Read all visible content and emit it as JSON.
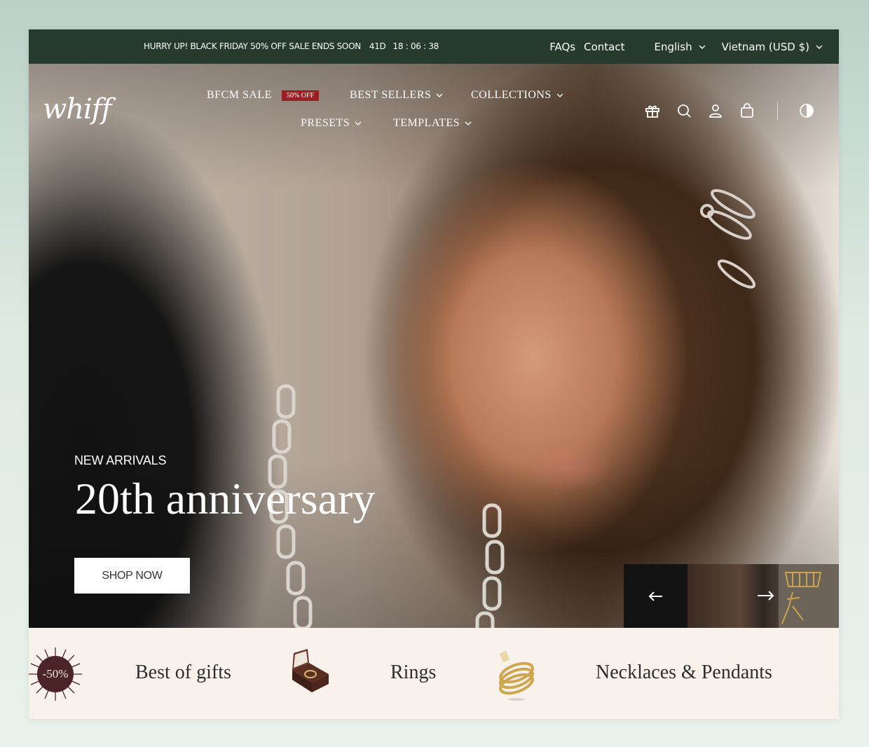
{
  "announcement": {
    "promo_text": "HURRY UP! BLACK FRIDAY 50% OFF SALE ENDS SOON",
    "countdown_days": "41D",
    "countdown_time": "18 : 06 : 38"
  },
  "top_links": {
    "faqs": "FAQs",
    "contact": "Contact",
    "language": "English",
    "currency": "Vietnam (USD $)"
  },
  "header": {
    "logo": "whiff",
    "nav": {
      "bfcm": "BFCM SALE",
      "bfcm_badge": "50% OFF",
      "best_sellers": "BEST SELLERS",
      "collections": "COLLECTIONS",
      "presets": "PRESETS",
      "templates": "TEMPLATES"
    },
    "icons": [
      "gift-icon",
      "search-icon",
      "account-icon",
      "cart-icon",
      "theme-toggle-icon"
    ]
  },
  "hero": {
    "eyebrow": "NEW ARRIVALS",
    "title": "20th anniversary",
    "cta": "SHOP NOW"
  },
  "categories": {
    "sale_badge": "-50%",
    "items": [
      "Best of gifts",
      "Rings",
      "Necklaces & Pendants"
    ]
  },
  "colors": {
    "topbar_bg": "#263a2e",
    "badge_bg": "#9a1e22",
    "category_bg": "#f9f1ec"
  }
}
